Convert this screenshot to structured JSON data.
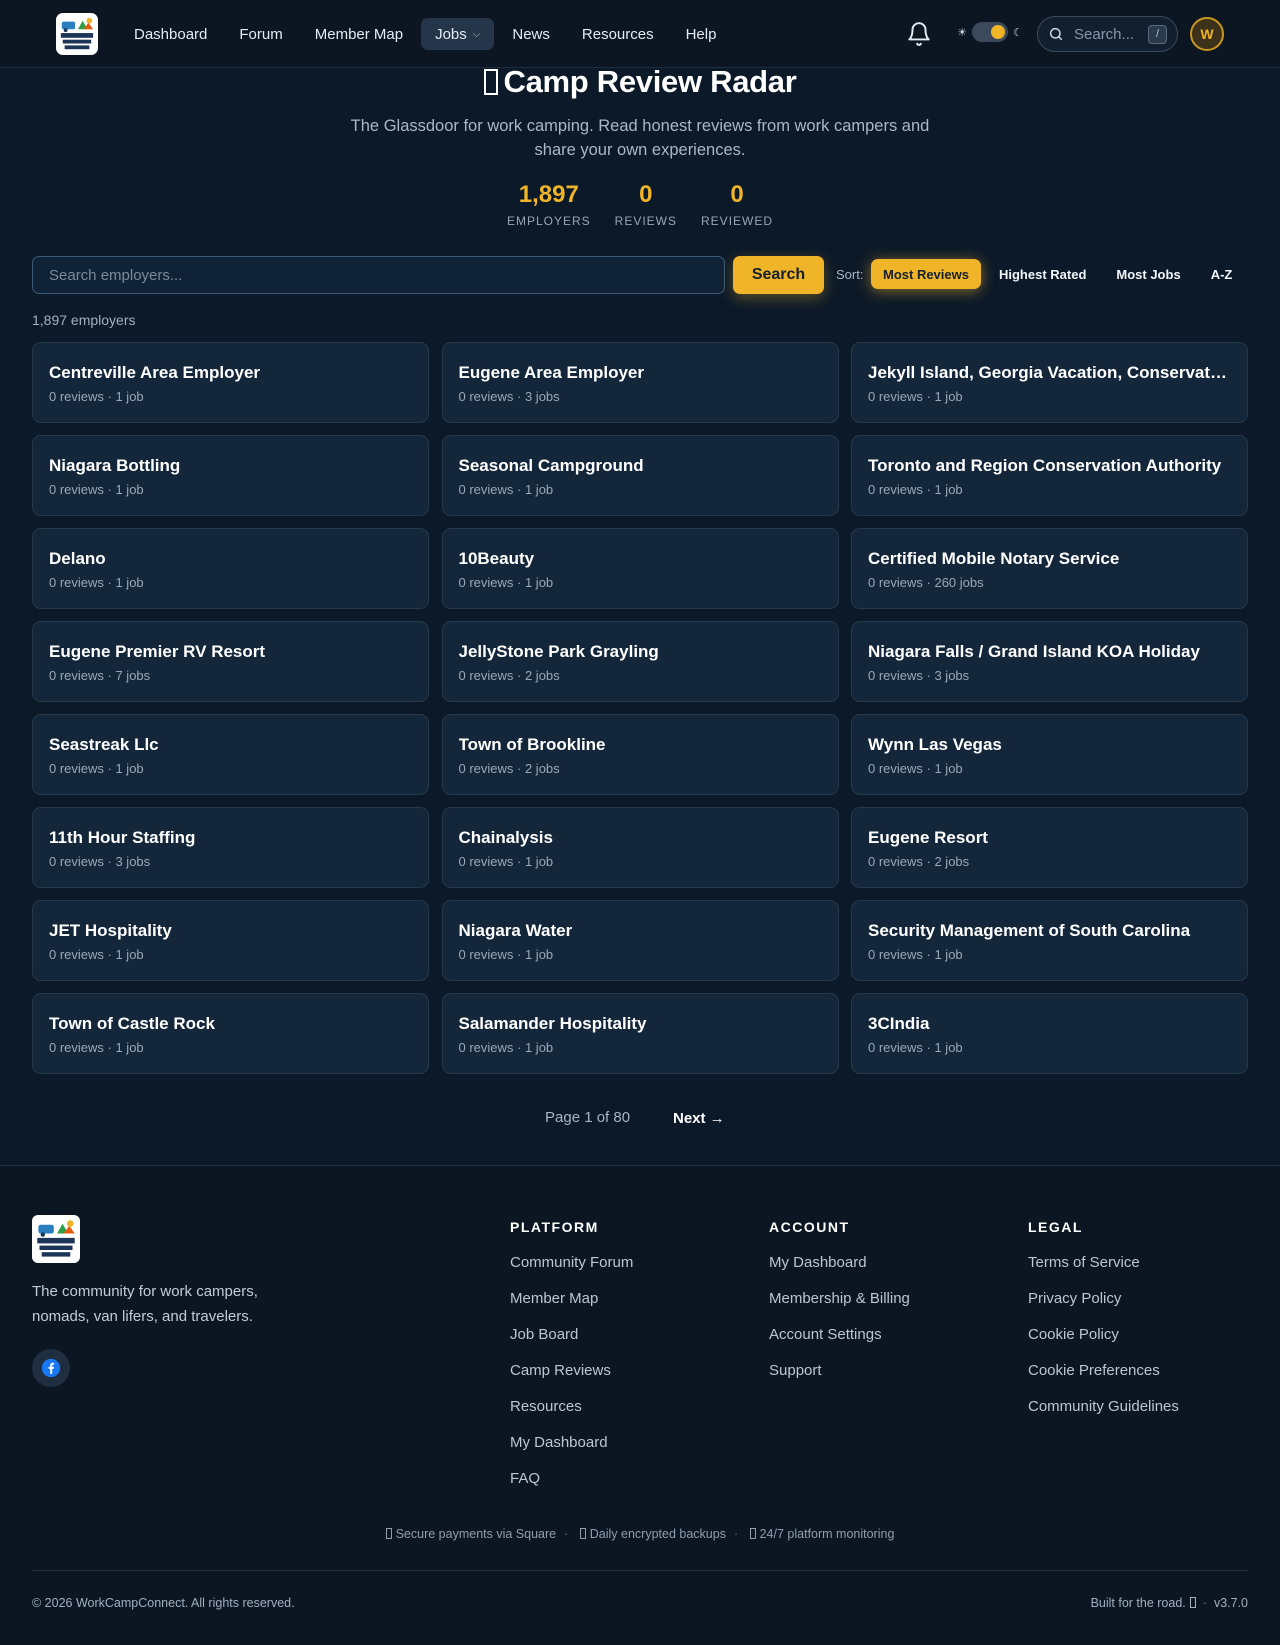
{
  "nav": {
    "links": [
      "Dashboard",
      "Forum",
      "Member Map",
      "Jobs",
      "News",
      "Resources",
      "Help"
    ],
    "search_placeholder": "Search...",
    "search_shortcut": "/",
    "avatar_initial": "W"
  },
  "hero": {
    "title": "Camp Review Radar",
    "subtitle": "The Glassdoor for work camping. Read honest reviews from work campers and share your own experiences.",
    "stats": [
      {
        "value": "1,897",
        "label": "EMPLOYERS"
      },
      {
        "value": "0",
        "label": "REVIEWS"
      },
      {
        "value": "0",
        "label": "REVIEWED"
      }
    ]
  },
  "search": {
    "placeholder": "Search employers...",
    "button_label": "Search",
    "sort_label": "Sort:",
    "sort_options": [
      "Most Reviews",
      "Highest Rated",
      "Most Jobs",
      "A-Z"
    ],
    "active_sort": "Most Reviews"
  },
  "results_count": "1,897 employers",
  "employers": [
    {
      "name": "Centreville Area Employer",
      "meta": "0 reviews · 1 job"
    },
    {
      "name": "Eugene Area Employer",
      "meta": "0 reviews · 3 jobs"
    },
    {
      "name": "Jekyll Island, Georgia Vacation, Conservation and Events",
      "meta": "0 reviews · 1 job"
    },
    {
      "name": "Niagara Bottling",
      "meta": "0 reviews · 1 job"
    },
    {
      "name": "Seasonal Campground",
      "meta": "0 reviews · 1 job"
    },
    {
      "name": "Toronto and Region Conservation Authority",
      "meta": "0 reviews · 1 job"
    },
    {
      "name": "Delano",
      "meta": "0 reviews · 1 job"
    },
    {
      "name": "10Beauty",
      "meta": "0 reviews · 1 job"
    },
    {
      "name": "Certified Mobile Notary Service",
      "meta": "0 reviews · 260 jobs"
    },
    {
      "name": "Eugene Premier RV Resort",
      "meta": "0 reviews · 7 jobs"
    },
    {
      "name": "JellyStone Park Grayling",
      "meta": "0 reviews · 2 jobs"
    },
    {
      "name": "Niagara Falls / Grand Island KOA Holiday",
      "meta": "0 reviews · 3 jobs"
    },
    {
      "name": "Seastreak Llc",
      "meta": "0 reviews · 1 job"
    },
    {
      "name": "Town of Brookline",
      "meta": "0 reviews · 2 jobs"
    },
    {
      "name": "Wynn Las Vegas",
      "meta": "0 reviews · 1 job"
    },
    {
      "name": "11th Hour Staffing",
      "meta": "0 reviews · 3 jobs"
    },
    {
      "name": "Chainalysis",
      "meta": "0 reviews · 1 job"
    },
    {
      "name": "Eugene Resort",
      "meta": "0 reviews · 2 jobs"
    },
    {
      "name": "JET Hospitality",
      "meta": "0 reviews · 1 job"
    },
    {
      "name": "Niagara Water",
      "meta": "0 reviews · 1 job"
    },
    {
      "name": "Security Management of South Carolina",
      "meta": "0 reviews · 1 job"
    },
    {
      "name": "Town of Castle Rock",
      "meta": "0 reviews · 1 job"
    },
    {
      "name": "Salamander Hospitality",
      "meta": "0 reviews · 1 job"
    },
    {
      "name": "3CIndia",
      "meta": "0 reviews · 1 job"
    }
  ],
  "pagination": {
    "status": "Page 1 of 80",
    "next_label": "Next →"
  },
  "footer": {
    "tagline": "The community for work campers, nomads, van lifers, and travelers.",
    "columns": [
      {
        "title": "PLATFORM",
        "links": [
          "Community Forum",
          "Member Map",
          "Job Board",
          "Camp Reviews",
          "Resources",
          "My Dashboard",
          "FAQ"
        ]
      },
      {
        "title": "ACCOUNT",
        "links": [
          "My Dashboard",
          "Membership & Billing",
          "Account Settings",
          "Support"
        ]
      },
      {
        "title": "LEGAL",
        "links": [
          "Terms of Service",
          "Privacy Policy",
          "Cookie Policy",
          "Cookie Preferences",
          "Community Guidelines"
        ]
      }
    ],
    "trust": [
      "Secure payments via Square",
      "Daily encrypted backups",
      "24/7 platform monitoring"
    ],
    "copyright": "© 2026 WorkCampConnect. All rights reserved.",
    "built": "Built for the road.",
    "version": "v3.7.0"
  },
  "colors": {
    "accent": "#f0b429",
    "background": "#0c1928",
    "card": "#14263a",
    "navbar": "#0b1622"
  }
}
